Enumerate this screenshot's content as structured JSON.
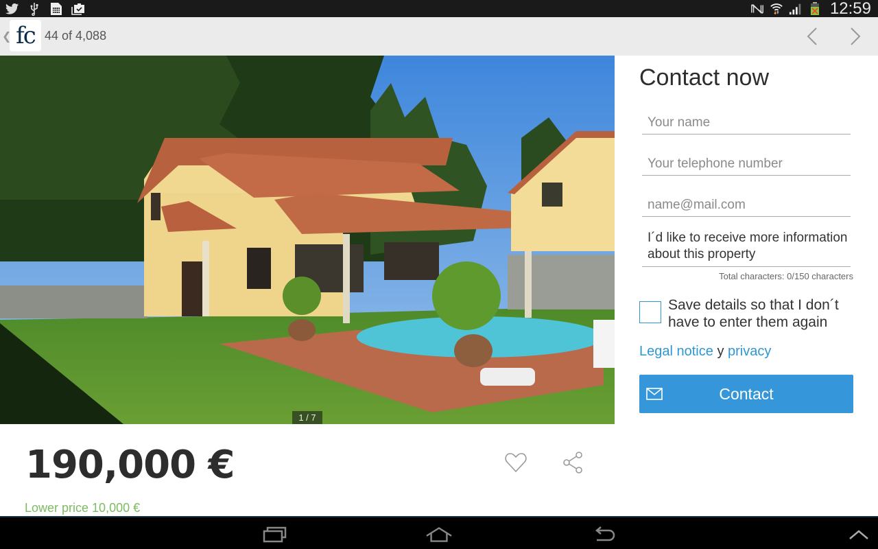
{
  "status_bar": {
    "left_icons": [
      "twitter-icon",
      "usb-icon",
      "sim-card-icon",
      "clipboard-check-icon"
    ],
    "right_icons": [
      "silent-mode-icon",
      "wifi-icon",
      "signal-icon",
      "battery-charging-icon"
    ],
    "time": "12:59"
  },
  "action_bar": {
    "app_logo": "fc",
    "counter": "44 of 4,088"
  },
  "gallery": {
    "counter": "1 / 7"
  },
  "listing": {
    "price": "190,000 €",
    "lower_price": "Lower price 10,000 €"
  },
  "contact_form": {
    "title": "Contact now",
    "name_placeholder": "Your name",
    "phone_placeholder": "Your telephone number",
    "email_placeholder": "name@mail.com",
    "message_value": "I´d like to receive more information about this property",
    "char_count": "Total characters: 0/150 characters",
    "save_details_label": "Save details so that I don´t have to enter them again",
    "save_details_checked": false,
    "legal_link": "Legal notice",
    "legal_conjunction": "y",
    "privacy_link": "privacy",
    "submit_label": "Contact"
  },
  "colors": {
    "accent": "#3597da",
    "price_drop": "#7cbb62",
    "logo": "#0c2b4a"
  }
}
